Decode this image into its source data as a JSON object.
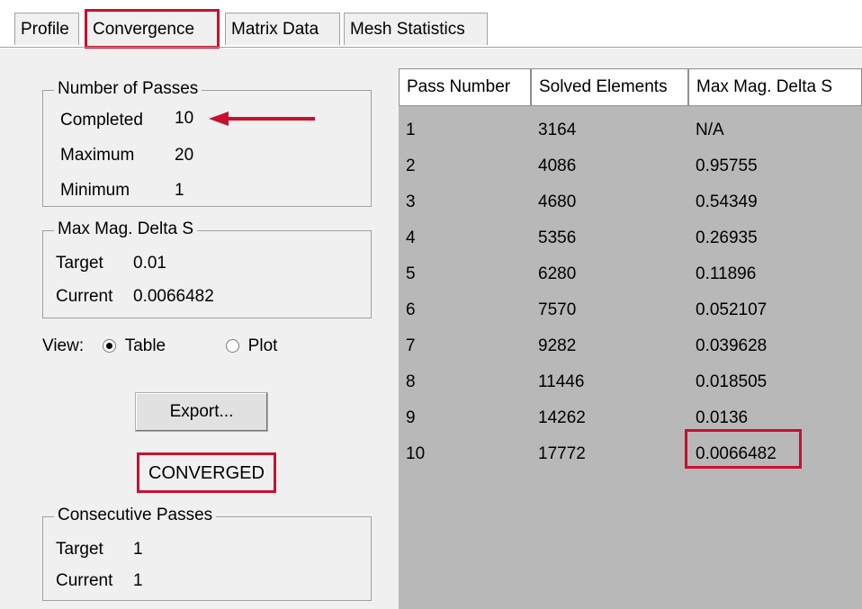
{
  "tabs": [
    "Profile",
    "Convergence",
    "Matrix Data",
    "Mesh Statistics"
  ],
  "passes": {
    "title": "Number of Passes",
    "completed_label": "Completed",
    "completed_value": "10",
    "maximum_label": "Maximum",
    "maximum_value": "20",
    "minimum_label": "Minimum",
    "minimum_value": "1"
  },
  "delta": {
    "title": "Max Mag. Delta S",
    "target_label": "Target",
    "target_value": "0.01",
    "current_label": "Current",
    "current_value": "0.0066482"
  },
  "view": {
    "label": "View:",
    "table": "Table",
    "plot": "Plot",
    "selected": "Table"
  },
  "export_label": "Export...",
  "status": "CONVERGED",
  "consecutive": {
    "title": "Consecutive Passes",
    "target_label": "Target",
    "target_value": "1",
    "current_label": "Current",
    "current_value": "1"
  },
  "table": {
    "headers": [
      "Pass Number",
      "Solved Elements",
      "Max Mag. Delta S"
    ],
    "rows": [
      [
        "1",
        "3164",
        "N/A"
      ],
      [
        "2",
        "4086",
        "0.95755"
      ],
      [
        "3",
        "4680",
        "0.54349"
      ],
      [
        "4",
        "5356",
        "0.26935"
      ],
      [
        "5",
        "6280",
        "0.11896"
      ],
      [
        "6",
        "7570",
        "0.052107"
      ],
      [
        "7",
        "9282",
        "0.039628"
      ],
      [
        "8",
        "11446",
        "0.018505"
      ],
      [
        "9",
        "14262",
        "0.0136"
      ],
      [
        "10",
        "17772",
        "0.0066482"
      ]
    ]
  },
  "colors": {
    "highlight": "#c8102e",
    "grid_bg": "#b8b8b8",
    "panel_bg": "#f0f0f0"
  }
}
